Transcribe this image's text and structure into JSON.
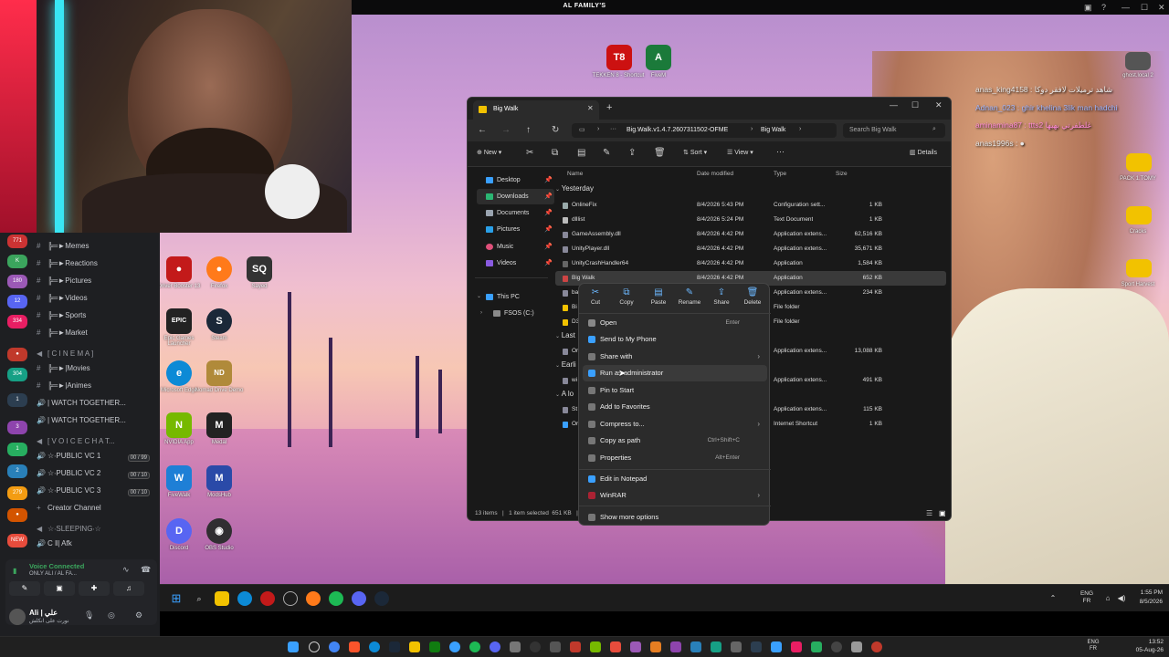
{
  "stream": {
    "title": "AL FAMILY'S"
  },
  "desktop_icons": [
    {
      "label": "TEKKEN 8 - Shortcut",
      "badge": "T8",
      "color": "#c11"
    },
    {
      "label": "FiveM",
      "badge": "A",
      "color": "#1b7a3a"
    },
    {
      "label": "Driver Booster 13",
      "badge": "●",
      "color": "#c31a1a"
    },
    {
      "label": "Firefox",
      "badge": "●",
      "color": "#ff7a1a"
    },
    {
      "label": "Sayed",
      "badge": "SQ",
      "color": "#333"
    },
    {
      "label": "Epic Games Launcher",
      "badge": "EPIC",
      "color": "#222"
    },
    {
      "label": "Steam",
      "badge": "S",
      "color": "#1b2838"
    },
    {
      "label": "Microsoft Edge",
      "badge": "e",
      "color": "#0c8ad6"
    },
    {
      "label": "Nomad Drive Demo",
      "badge": "ND",
      "color": "#b08a3a"
    },
    {
      "label": "NVIDIA App",
      "badge": "N",
      "color": "#76b900"
    },
    {
      "label": "Medal",
      "badge": "M",
      "color": "#222"
    },
    {
      "label": "FiveWalk",
      "badge": "W",
      "color": "#1e7fd6"
    },
    {
      "label": "ModsHub",
      "badge": "M",
      "color": "#2a4aa8"
    },
    {
      "label": "Discord",
      "badge": "D",
      "color": "#5865f2"
    },
    {
      "label": "OBS Studio",
      "badge": "◉",
      "color": "#302e31"
    },
    {
      "label": "PACK 1.TOMY",
      "badge": "",
      "color": "#f2c200"
    },
    {
      "label": "Cracks",
      "badge": "",
      "color": "#f2c200"
    },
    {
      "label": "Sport Harvest",
      "badge": "",
      "color": "#f2c200"
    },
    {
      "label": "ghost.local 2",
      "badge": "",
      "color": "#555"
    }
  ],
  "discord": {
    "channels": [
      {
        "name": "╠═►Memes",
        "icon": "#"
      },
      {
        "name": "╠═►Reactions",
        "icon": "#"
      },
      {
        "name": "╠═►Pictures",
        "icon": "#"
      },
      {
        "name": "╠═►Videos",
        "icon": "#"
      },
      {
        "name": "╠═►Sports",
        "icon": "#"
      },
      {
        "name": "╠═►Market",
        "icon": "#"
      },
      {
        "name": "[ C I N E M A ]",
        "icon": "◀"
      },
      {
        "name": "╠═►|Movies",
        "icon": "#"
      },
      {
        "name": "╠═►|Animes",
        "icon": "#"
      },
      {
        "name": "| WATCH TOGETHER...",
        "icon": "🔊"
      },
      {
        "name": "| WATCH TOGETHER...",
        "icon": "🔊"
      },
      {
        "name": "[ V O I C E  C H A T...",
        "icon": "◀"
      },
      {
        "name": "☆∙PUBLIC VC 1",
        "icon": "🔊",
        "count": "00 / 99"
      },
      {
        "name": "☆∙PUBLIC VC 2",
        "icon": "🔊",
        "count": "00 / 10"
      },
      {
        "name": "☆∙PUBLIC VC 3",
        "icon": "🔊",
        "count": "00 / 10"
      },
      {
        "name": "Creator Channel",
        "icon": "+"
      },
      {
        "name": "☆∙SLEEPING∙☆",
        "icon": "◀"
      },
      {
        "name": "C ‖| Afk",
        "icon": "🔊"
      }
    ],
    "voice_status": "Voice Connected",
    "voice_channel": "ONLY ALI / AL FA...",
    "user_name": "Ali | علي",
    "user_status": "نورت على انكلش"
  },
  "explorer": {
    "tab_title": "Big Walk",
    "path": [
      "Big.Walk.v1.4.7.2607311502-OFME",
      "Big Walk"
    ],
    "search_placeholder": "Search Big Walk",
    "toolbar": {
      "new": "New",
      "sort": "Sort",
      "view": "View",
      "details": "Details"
    },
    "nav": [
      {
        "label": "Desktop",
        "color": "#3aa0ff"
      },
      {
        "label": "Downloads",
        "color": "#2bb673"
      },
      {
        "label": "Documents",
        "color": "#9aa4b0"
      },
      {
        "label": "Pictures",
        "color": "#2aa0e8"
      },
      {
        "label": "Music",
        "color": "#e0507a"
      },
      {
        "label": "Videos",
        "color": "#8a5be0"
      },
      {
        "label": "This PC",
        "color": "#3aa0ff"
      },
      {
        "label": "FSOS (C:)",
        "color": "#8a8a8a"
      }
    ],
    "columns": [
      "Name",
      "Date modified",
      "Type",
      "Size"
    ],
    "group_yesterday": "Yesterday",
    "group_last": "Last",
    "group_earlier": "Earli",
    "group_along": "A lo",
    "files": [
      {
        "name": "OnlineFix",
        "date": "8/4/2026 5:43 PM",
        "type": "Configuration sett...",
        "size": "1 KB"
      },
      {
        "name": "dlllist",
        "date": "8/4/2026 5:24 PM",
        "type": "Text Document",
        "size": "1 KB"
      },
      {
        "name": "GameAssembly.dll",
        "date": "8/4/2026 4:42 PM",
        "type": "Application extens...",
        "size": "62,516 KB"
      },
      {
        "name": "UnityPlayer.dll",
        "date": "8/4/2026 4:42 PM",
        "type": "Application extens...",
        "size": "35,671 KB"
      },
      {
        "name": "UnityCrashHandler64",
        "date": "8/4/2026 4:42 PM",
        "type": "Application",
        "size": "1,584 KB"
      },
      {
        "name": "Big Walk",
        "date": "8/4/2026 4:42 PM",
        "type": "Application",
        "size": "652 KB"
      },
      {
        "name": "ba",
        "date": "",
        "type": "Application extens...",
        "size": "234 KB"
      },
      {
        "name": "Bi",
        "date": "",
        "type": "File folder",
        "size": ""
      },
      {
        "name": "D3",
        "date": "",
        "type": "File folder",
        "size": ""
      },
      {
        "name": "Or",
        "date": "",
        "type": "Application extens...",
        "size": "13,088 KB"
      },
      {
        "name": "wi",
        "date": "",
        "type": "Application extens...",
        "size": "491 KB"
      },
      {
        "name": "St",
        "date": "",
        "type": "Application extens...",
        "size": "115 KB"
      },
      {
        "name": "Or",
        "date": "",
        "type": "Internet Shortcut",
        "size": "1 KB"
      }
    ],
    "status": "13 items   |   1 item selected  651 KB   |"
  },
  "context_menu": {
    "quick": [
      "Cut",
      "Copy",
      "Paste",
      "Rename",
      "Share",
      "Delete"
    ],
    "items": [
      {
        "label": "Open",
        "shortcut": "Enter"
      },
      {
        "label": "Send to My Phone"
      },
      {
        "label": "Share with",
        "submenu": true
      },
      {
        "label": "Run as administrator"
      },
      {
        "label": "Pin to Start"
      },
      {
        "label": "Add to Favorites"
      },
      {
        "label": "Compress to...",
        "submenu": true
      },
      {
        "label": "Copy as path",
        "shortcut": "Ctrl+Shift+C"
      },
      {
        "label": "Properties",
        "shortcut": "Alt+Enter"
      },
      {
        "label": "Edit in Notepad"
      },
      {
        "label": "WinRAR",
        "submenu": true
      },
      {
        "label": "Show more options"
      }
    ]
  },
  "chat": [
    {
      "text": "anas_king4158 : شاهد ترميلات لافقر دوكا",
      "color": "#e8e8e8"
    },
    {
      "text": "Adnan_023 : ghir khelina 3lik man hadchi",
      "color": "#9fb6ff"
    },
    {
      "text": "aminamina87 : ‏ttts2 غلطفرتي بهيها",
      "color": "#ff8ad8"
    },
    {
      "text": "anas1996s : ●",
      "color": "#e8e8e8"
    }
  ],
  "taskbar": {
    "lang": "ENG FR",
    "time": "1:55 PM",
    "date": "8/5/2026"
  },
  "taskbar2": {
    "lang": "ENG FR",
    "time": "13:52",
    "date": "05-Aug-26"
  }
}
